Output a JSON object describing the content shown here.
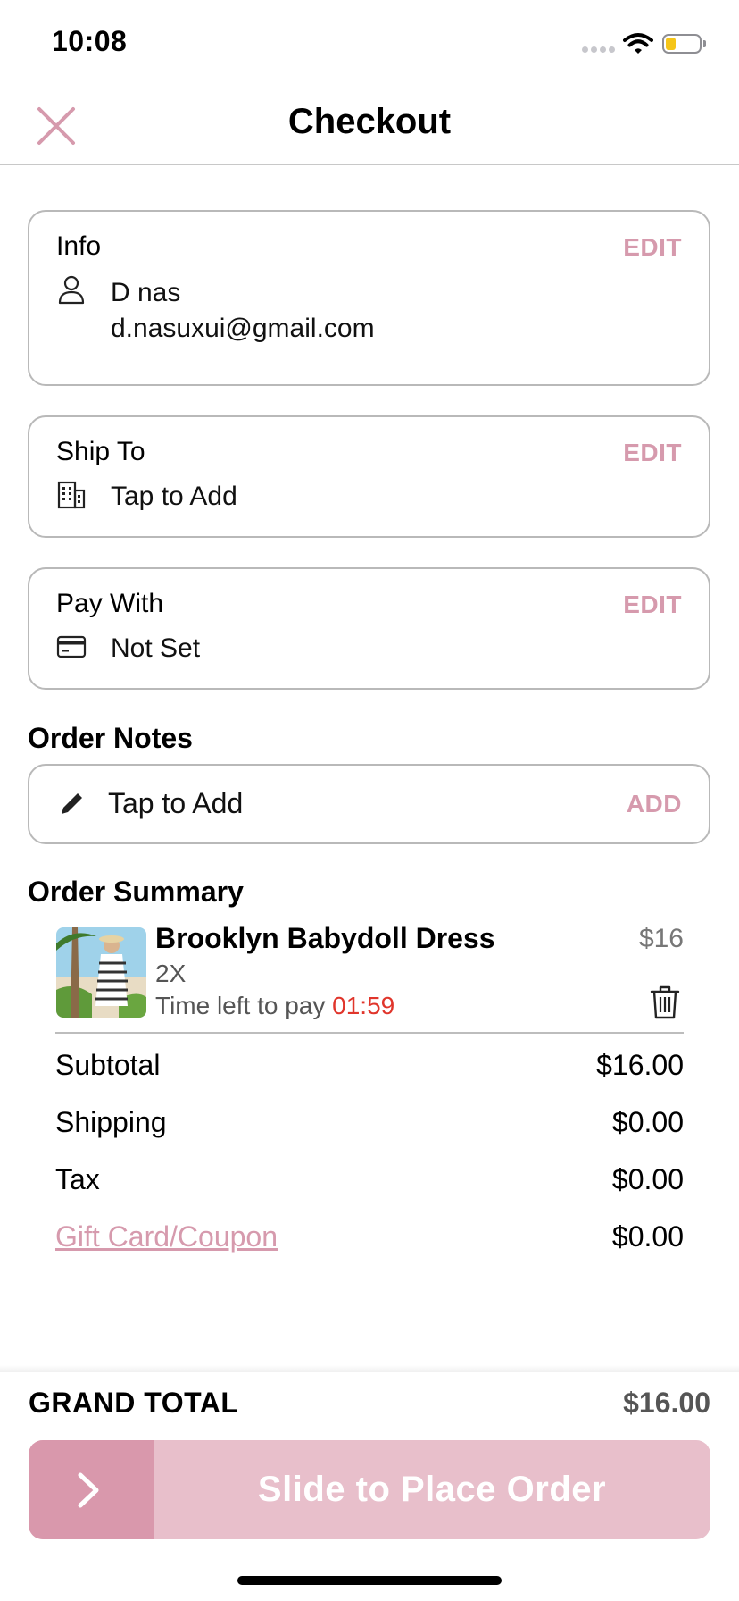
{
  "status_bar": {
    "time": "10:08"
  },
  "nav": {
    "title": "Checkout"
  },
  "info": {
    "label": "Info",
    "edit_label": "EDIT",
    "name": "D nas",
    "email": "d.nasuxui@gmail.com"
  },
  "ship_to": {
    "label": "Ship To",
    "edit_label": "EDIT",
    "value": "Tap to Add"
  },
  "pay_with": {
    "label": "Pay With",
    "edit_label": "EDIT",
    "value": "Not Set"
  },
  "order_notes": {
    "title": "Order Notes",
    "placeholder": "Tap to Add",
    "add_label": "ADD"
  },
  "order_summary": {
    "title": "Order Summary",
    "item": {
      "name": "Brooklyn Babydoll Dress",
      "size": "2X",
      "time_label": "Time left to pay",
      "countdown": "01:59",
      "price": "$16"
    },
    "rows": [
      {
        "label": "Subtotal",
        "value": "$16.00"
      },
      {
        "label": "Shipping",
        "value": "$0.00"
      },
      {
        "label": "Tax",
        "value": "$0.00"
      },
      {
        "label": "Gift Card/Coupon",
        "value": "$0.00"
      }
    ]
  },
  "footer": {
    "grand_total_label": "GRAND TOTAL",
    "grand_total_value": "$16.00",
    "slide_label": "Slide to Place Order"
  },
  "colors": {
    "accent": "#d69aad",
    "slider_bg": "#e8bfcb",
    "slider_knob": "#d998ac",
    "countdown": "#e0352b"
  }
}
